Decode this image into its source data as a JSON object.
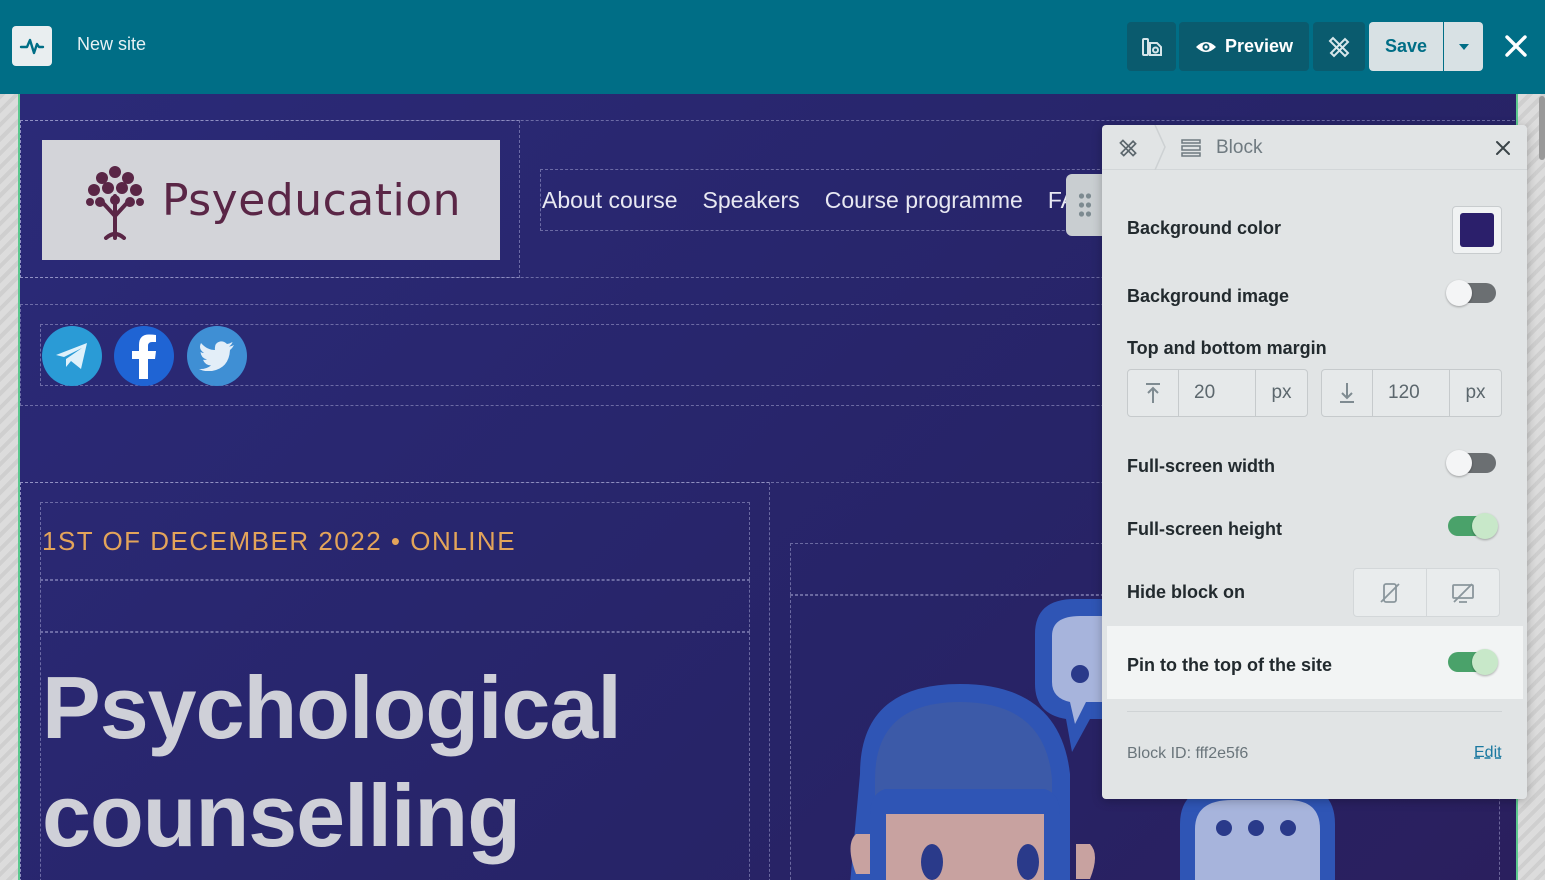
{
  "topbar": {
    "site_title": "New site",
    "preview_label": "Preview",
    "save_label": "Save"
  },
  "site": {
    "logo_text": "Psyeducation",
    "nav": [
      "About course",
      "Speakers",
      "Course programme",
      "FAQ"
    ],
    "social": [
      "telegram",
      "facebook",
      "twitter"
    ],
    "date_line": "1ST OF DECEMBER 2022 • ONLINE",
    "headline_1": "Psychological",
    "headline_2": "counselling"
  },
  "panel": {
    "title": "Block",
    "background_color_label": "Background color",
    "background_color": "#2b1f6b",
    "background_image_label": "Background image",
    "background_image_on": false,
    "margin_label": "Top and bottom margin",
    "margin_top": "20",
    "margin_bottom": "120",
    "unit": "px",
    "fullscreen_width_label": "Full-screen width",
    "fullscreen_width_on": false,
    "fullscreen_height_label": "Full-screen height",
    "fullscreen_height_on": true,
    "hide_label": "Hide block on",
    "pin_label": "Pin to the top of the site",
    "pin_on": true,
    "block_id": "Block ID: fff2e5f6",
    "edit_label": "Edit"
  },
  "colors": {
    "topbar": "#006e86",
    "site_bg": "#272468",
    "accent_orange": "#e3a45a",
    "toggle_on": "#4aa26a"
  }
}
